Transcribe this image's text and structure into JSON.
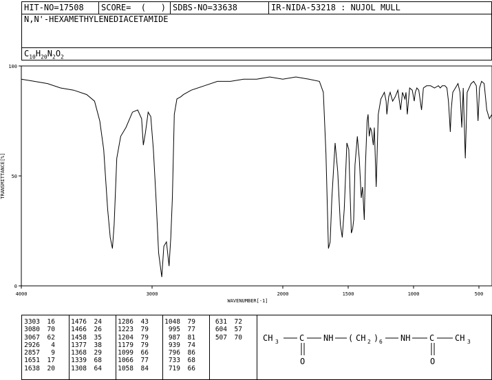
{
  "header": {
    "hit_no": "HIT-NO=17508",
    "score": "SCORE=  (   )",
    "sdbs_no": "SDBS-NO=33638",
    "method": "IR-NIDA-53218 : NUJOL MULL",
    "compound_name": "N,N'-HEXAMETHYLENEDIACETAMIDE",
    "formula": {
      "c": "10",
      "h": "20",
      "n": "2",
      "o": "2"
    }
  },
  "chart_data": {
    "type": "line",
    "title": "",
    "xlabel": "WAVENUMBER[-1]",
    "ylabel": "TRANSMITTANCE[%]",
    "xlim": [
      4000,
      400
    ],
    "ylim": [
      0,
      100
    ],
    "x_reversed": true,
    "xticks": [
      4000,
      3000,
      2000,
      1500,
      1000,
      500
    ],
    "yticks": [
      0,
      50,
      100
    ],
    "grid": false,
    "series": [
      {
        "x": [
          4000,
          3900,
          3800,
          3700,
          3600,
          3500,
          3440,
          3400,
          3370,
          3340,
          3320,
          3303,
          3290,
          3270,
          3240,
          3200,
          3150,
          3110,
          3080,
          3067,
          3050,
          3030,
          3010,
          2990,
          2970,
          2950,
          2926,
          2910,
          2890,
          2870,
          2857,
          2845,
          2830,
          2810,
          2780,
          2760,
          2700,
          2600,
          2500,
          2400,
          2300,
          2200,
          2100,
          2000,
          1900,
          1800,
          1720,
          1690,
          1670,
          1651,
          1638,
          1625,
          1600,
          1580,
          1560,
          1545,
          1530,
          1510,
          1495,
          1485,
          1476,
          1466,
          1458,
          1448,
          1430,
          1415,
          1400,
          1390,
          1377,
          1368,
          1355,
          1348,
          1339,
          1330,
          1320,
          1308,
          1300,
          1286,
          1270,
          1250,
          1223,
          1210,
          1204,
          1190,
          1179,
          1160,
          1140,
          1120,
          1099,
          1085,
          1066,
          1058,
          1048,
          1030,
          1010,
          995,
          987,
          975,
          960,
          939,
          925,
          900,
          870,
          840,
          810,
          796,
          780,
          760,
          745,
          733,
          725,
          719,
          712,
          700,
          680,
          660,
          645,
          631,
          620,
          604,
          590,
          560,
          540,
          520,
          507,
          495,
          480,
          460,
          440,
          420,
          400
        ],
        "y": [
          94,
          93,
          92,
          90,
          89,
          87,
          84,
          75,
          62,
          35,
          22,
          17,
          28,
          58,
          68,
          72,
          79,
          80,
          76,
          64,
          70,
          79,
          77,
          62,
          40,
          15,
          4,
          18,
          20,
          9,
          22,
          40,
          78,
          85,
          86,
          87,
          89,
          91,
          93,
          93,
          94,
          94,
          95,
          94,
          95,
          94,
          93,
          88,
          60,
          17,
          20,
          40,
          65,
          52,
          28,
          22,
          35,
          65,
          62,
          42,
          24,
          26,
          30,
          55,
          68,
          58,
          40,
          45,
          30,
          55,
          75,
          78,
          68,
          72,
          70,
          64,
          72,
          45,
          78,
          85,
          88,
          84,
          78,
          86,
          88,
          84,
          86,
          89,
          80,
          88,
          85,
          88,
          78,
          90,
          89,
          84,
          88,
          90,
          89,
          80,
          90,
          91,
          91,
          90,
          91,
          90,
          91,
          91,
          90,
          84,
          76,
          70,
          80,
          88,
          90,
          92,
          88,
          72,
          90,
          58,
          88,
          92,
          93,
          91,
          75,
          90,
          93,
          92,
          80,
          76,
          78
        ]
      }
    ]
  },
  "peaks": [
    [
      [
        "3303",
        "16"
      ],
      [
        "3080",
        "70"
      ],
      [
        "3067",
        "62"
      ],
      [
        "2926",
        "4"
      ],
      [
        "2857",
        "9"
      ],
      [
        "1651",
        "17"
      ],
      [
        "1638",
        "20"
      ]
    ],
    [
      [
        "1476",
        "24"
      ],
      [
        "1466",
        "26"
      ],
      [
        "1458",
        "35"
      ],
      [
        "1377",
        "38"
      ],
      [
        "1368",
        "29"
      ],
      [
        "1339",
        "68"
      ],
      [
        "1308",
        "64"
      ]
    ],
    [
      [
        "1286",
        "43"
      ],
      [
        "1223",
        "79"
      ],
      [
        "1204",
        "79"
      ],
      [
        "1179",
        "79"
      ],
      [
        "1099",
        "66"
      ],
      [
        "1066",
        "77"
      ],
      [
        "1058",
        "84"
      ]
    ],
    [
      [
        "1048",
        "79"
      ],
      [
        "995",
        "77"
      ],
      [
        "987",
        "81"
      ],
      [
        "939",
        "74"
      ],
      [
        "796",
        "86"
      ],
      [
        "733",
        "68"
      ],
      [
        "719",
        "66"
      ]
    ],
    [
      [
        "631",
        "72"
      ],
      [
        "604",
        "57"
      ],
      [
        "507",
        "70"
      ]
    ]
  ],
  "structure": {
    "ch3_left": "CH",
    "sub3": "3",
    "c_left": "C",
    "nh_left": "NH",
    "lparen": "(",
    "ch2": "CH",
    "sub2": "2",
    "rparen": ")",
    "sub6": "6",
    "nh_right": "NH",
    "c_right": "C",
    "ch3_right": "CH",
    "o_left": "O",
    "o_right": "O"
  }
}
